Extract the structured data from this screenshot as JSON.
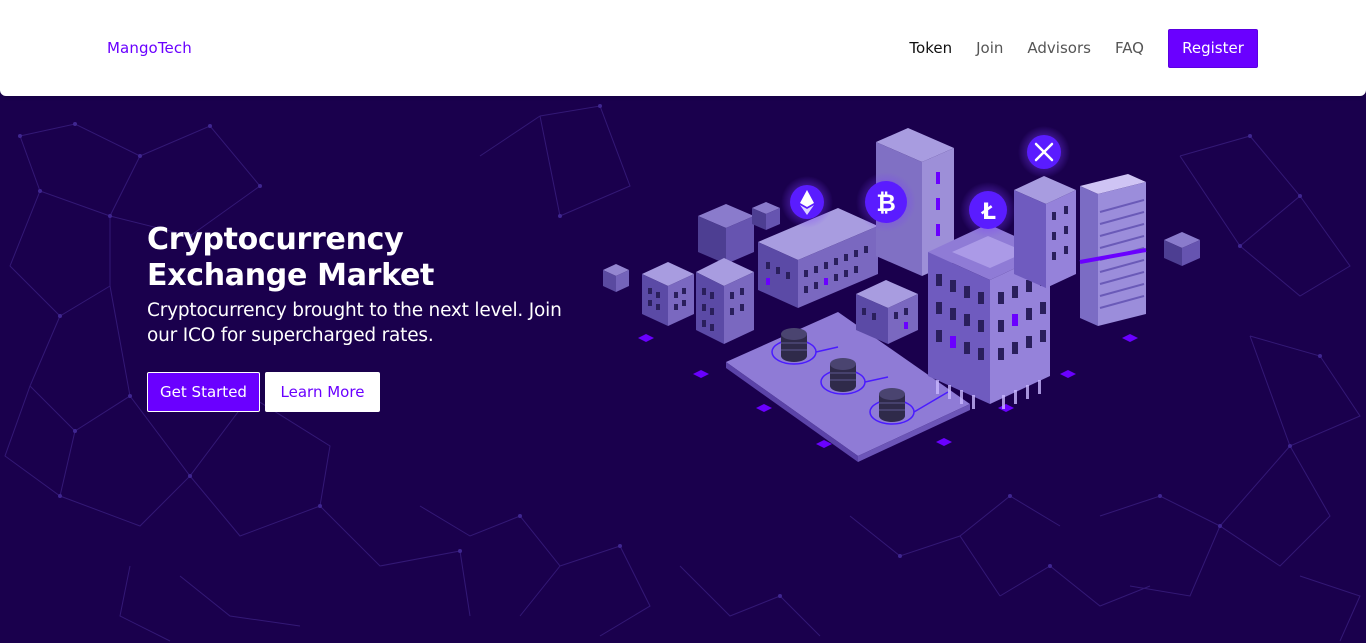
{
  "navbar": {
    "brand": "MangoTech",
    "links": [
      "Token",
      "Join",
      "Advisors",
      "FAQ"
    ],
    "register_label": "Register"
  },
  "hero": {
    "title": "Cryptocurrency Exchange Market",
    "subtitle": "Cryptocurrency brought to the next level. Join our ICO for supercharged rates.",
    "primary_button": "Get Started",
    "secondary_button": "Learn More"
  },
  "colors": {
    "accent": "#6a00ff",
    "hero_background": "#1a004d",
    "navbar_background": "#ffffff"
  },
  "illustration": {
    "coin_icons": [
      "ethereum-icon",
      "bitcoin-icon",
      "litecoin-icon",
      "ripple-icon"
    ]
  }
}
